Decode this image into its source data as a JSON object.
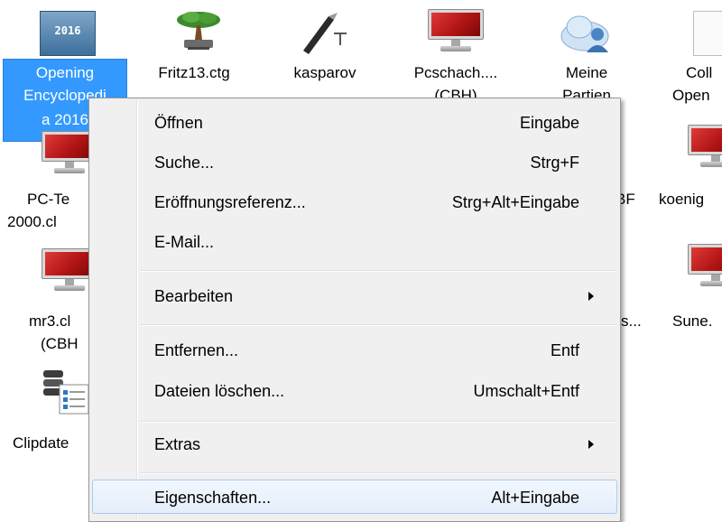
{
  "desktop": {
    "icons": [
      {
        "label1": "Opening",
        "label2": "Encyclopedi",
        "label3": "a 2016",
        "thumb_text": "2016"
      },
      {
        "label1": "Fritz13.ctg"
      },
      {
        "label1": "kasparov"
      },
      {
        "label1": "Pcschach....",
        "label2": "(CBH)"
      },
      {
        "label1": "Meine",
        "label2": "Partien"
      },
      {
        "label1": "Coll",
        "label2": "Open"
      },
      {
        "label1": "PC-Te",
        "label2": "2000.cl"
      },
      {
        "label1": "koenig"
      },
      {
        "label1": "BF"
      },
      {
        "label1": "mr3.cl",
        "label2": "(CBH"
      },
      {
        "label1": "s..."
      },
      {
        "label1": "Sune."
      },
      {
        "label1": "Clipdate"
      }
    ]
  },
  "context_menu": {
    "items": [
      {
        "label": "Öffnen",
        "shortcut": "Eingabe"
      },
      {
        "label": "Suche...",
        "shortcut": "Strg+F"
      },
      {
        "label": "Eröffnungsreferenz...",
        "shortcut": "Strg+Alt+Eingabe"
      },
      {
        "label": "E-Mail...",
        "shortcut": ""
      },
      {
        "label": "Bearbeiten",
        "shortcut": ""
      },
      {
        "label": "Entfernen...",
        "shortcut": "Entf"
      },
      {
        "label": "Dateien löschen...",
        "shortcut": "Umschalt+Entf"
      },
      {
        "label": "Extras",
        "shortcut": ""
      },
      {
        "label": "Eigenschaften...",
        "shortcut": "Alt+Eingabe"
      }
    ]
  }
}
